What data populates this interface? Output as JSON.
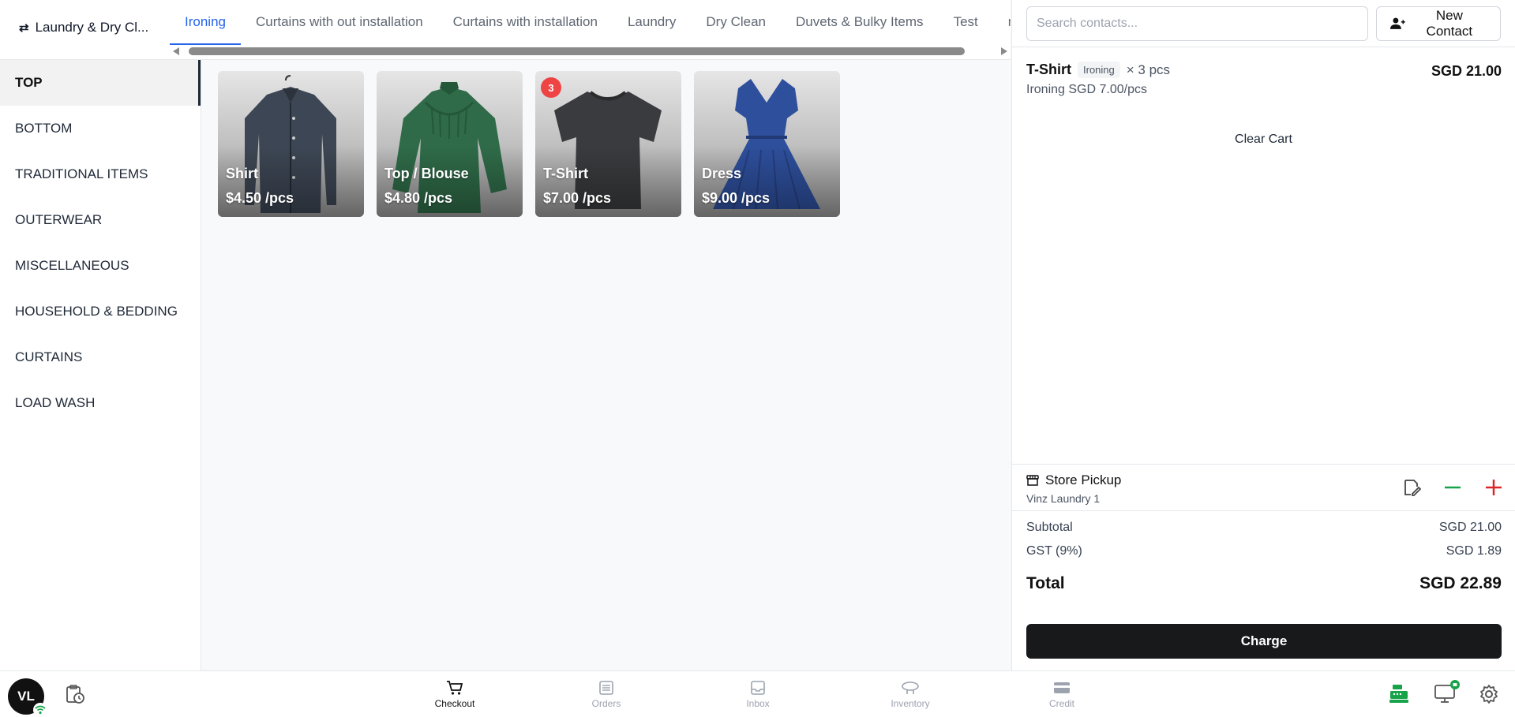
{
  "header": {
    "store_name": "Laundry & Dry Cl...",
    "tabs": [
      {
        "label": "Ironing",
        "active": true
      },
      {
        "label": "Curtains with out installation"
      },
      {
        "label": "Curtains with installation"
      },
      {
        "label": "Laundry"
      },
      {
        "label": "Dry Clean"
      },
      {
        "label": "Duvets & Bulky Items"
      },
      {
        "label": "Test"
      },
      {
        "label": "m"
      }
    ]
  },
  "categories": [
    {
      "label": "TOP",
      "active": true
    },
    {
      "label": "BOTTOM"
    },
    {
      "label": "TRADITIONAL ITEMS"
    },
    {
      "label": "OUTERWEAR"
    },
    {
      "label": "MISCELLANEOUS"
    },
    {
      "label": "HOUSEHOLD & BEDDING"
    },
    {
      "label": "CURTAINS"
    },
    {
      "label": "LOAD WASH"
    }
  ],
  "products": [
    {
      "name": "Shirt",
      "price": "$4.50 /pcs",
      "badge": ""
    },
    {
      "name": "Top / Blouse",
      "price": "$4.80 /pcs",
      "badge": ""
    },
    {
      "name": "T-Shirt",
      "price": "$7.00 /pcs",
      "badge": "3"
    },
    {
      "name": "Dress",
      "price": "$9.00 /pcs",
      "badge": ""
    }
  ],
  "cart": {
    "search_placeholder": "Search contacts...",
    "new_contact_label": "New Contact",
    "item": {
      "name": "T-Shirt",
      "tag": "Ironing",
      "qty": "× 3 pcs",
      "total": "SGD 21.00",
      "detail": "Ironing SGD 7.00/pcs"
    },
    "clear_label": "Clear Cart",
    "pickup_title": "Store Pickup",
    "pickup_store": "Vinz Laundry 1",
    "subtotal_label": "Subtotal",
    "subtotal_value": "SGD 21.00",
    "gst_label": "GST (9%)",
    "gst_value": "SGD 1.89",
    "total_label": "Total",
    "total_value": "SGD 22.89",
    "charge_label": "Charge"
  },
  "bottom": {
    "avatar_initials": "VL",
    "nav": [
      {
        "label": "Checkout",
        "icon": "cart-icon",
        "active": true
      },
      {
        "label": "Orders",
        "icon": "orders-icon"
      },
      {
        "label": "Inbox",
        "icon": "inbox-icon"
      },
      {
        "label": "Inventory",
        "icon": "inventory-icon"
      },
      {
        "label": "Credit",
        "icon": "credit-icon"
      }
    ]
  },
  "colors": {
    "accent": "#2563eb",
    "badge": "#ef4444",
    "minus": "#16a34a",
    "plus": "#dc2626",
    "charge_bg": "#18191b",
    "register": "#16a34a"
  }
}
